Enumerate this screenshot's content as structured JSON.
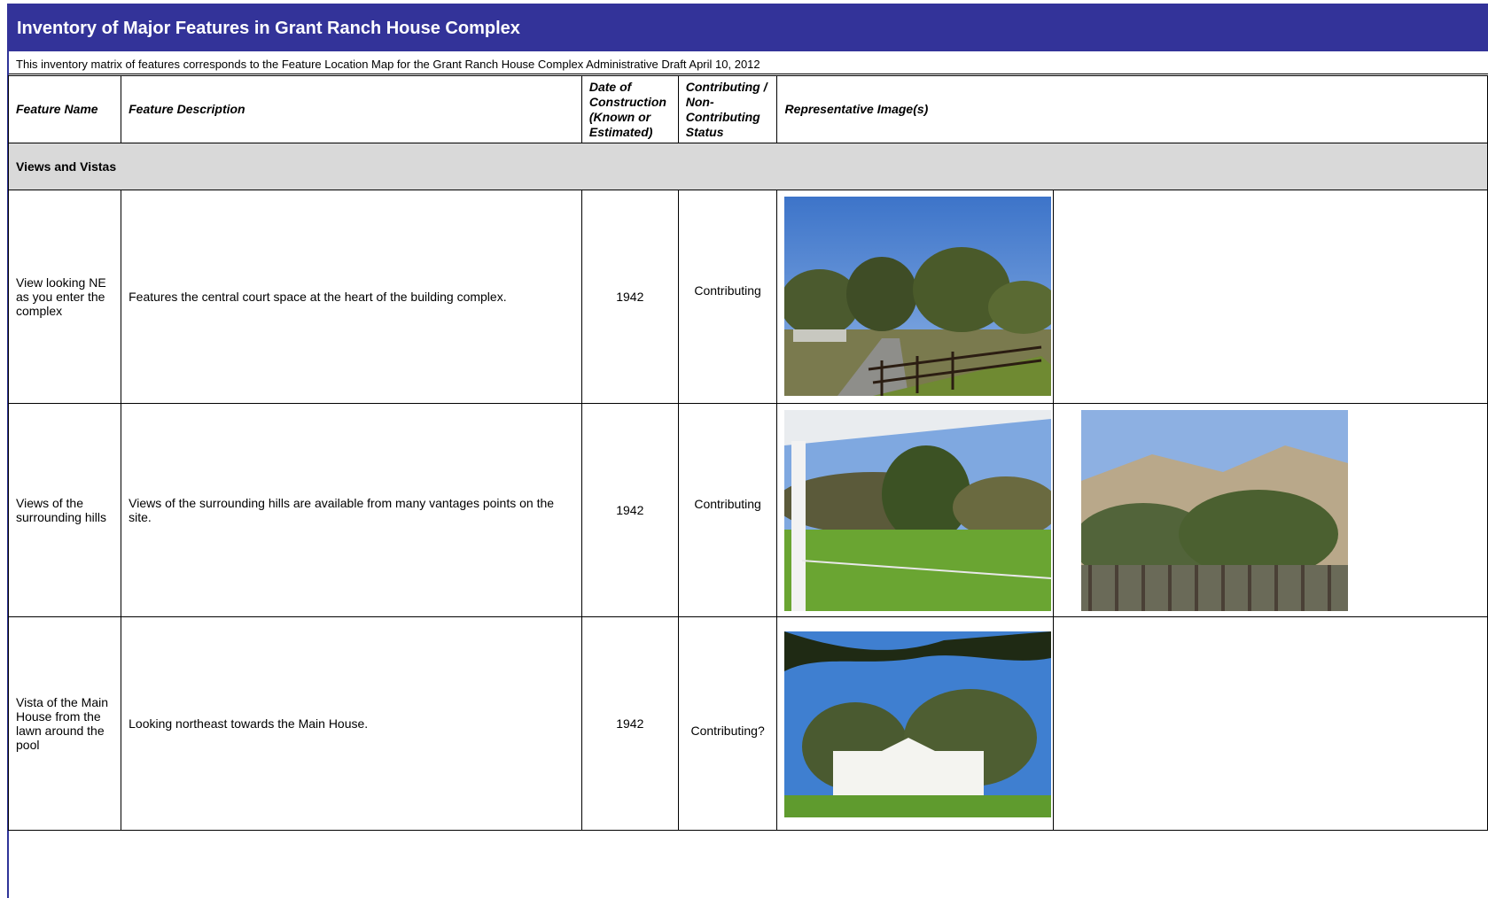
{
  "header": {
    "title": "Inventory of Major Features in Grant Ranch House Complex",
    "subtitle": "This inventory matrix of features corresponds to the Feature Location Map for the Grant Ranch House Complex Administrative Draft April 10, 2012"
  },
  "columns": {
    "name": "Feature Name",
    "description": "Feature Description",
    "date": "Date of Construction (Known or Estimated)",
    "status": "Contributing / Non-Contributing Status",
    "images": "Representative Image(s)"
  },
  "section": {
    "title": "Views and Vistas"
  },
  "rows": [
    {
      "name": "View looking NE as you enter the complex",
      "description": "Features the central court space at the heart of the building complex.",
      "date": "1942",
      "status": "Contributing"
    },
    {
      "name": "Views of the surrounding hills",
      "description": "Views of the surrounding hills are available from many vantages points on the site.",
      "date": "1942",
      "status": "Contributing"
    },
    {
      "name": "Vista of the Main House from the lawn around the pool",
      "description": "Looking northeast towards the Main House.",
      "date": "1942",
      "status": "Contributing?"
    }
  ]
}
